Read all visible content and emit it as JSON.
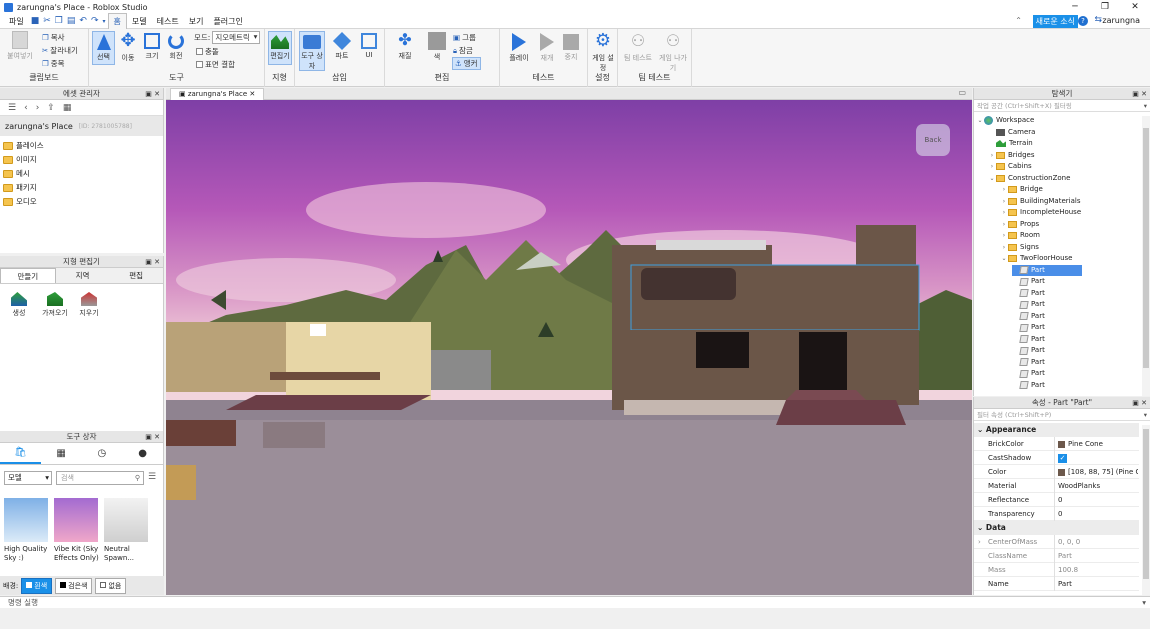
{
  "window": {
    "title": "zarungna's Place - Roblox Studio"
  },
  "menubar": {
    "items": [
      "파일",
      "홈",
      "모델",
      "테스트",
      "보기",
      "플러그인"
    ],
    "news": "새로운 소식",
    "user": "zarungna"
  },
  "ribbon": {
    "clipboard": {
      "label": "클립보드",
      "paste": "붙여넣기",
      "copy": "복사",
      "cut": "잘라내기",
      "duplicate": "중복"
    },
    "tools": {
      "label": "도구",
      "select": "선택",
      "move": "이동",
      "scale": "크기",
      "rotate": "회전",
      "mode_label": "모드:",
      "mode_value": "지오메트릭",
      "collisions": "충돌",
      "join_surfaces": "표면 결합"
    },
    "terrain": {
      "label": "지형",
      "editor": "편집기"
    },
    "insert": {
      "label": "삽입",
      "toolbox": "도구 상자",
      "part": "파트",
      "ui": "UI"
    },
    "edit": {
      "label": "편집",
      "material": "재질",
      "color": "색",
      "group": "그룹",
      "lock": "잠금",
      "anchor": "앵커"
    },
    "test": {
      "label": "테스트",
      "play": "플레이",
      "resume": "재개",
      "stop": "중지"
    },
    "settings": {
      "label": "설정",
      "game_settings": "게임 설정"
    },
    "team_test": {
      "label": "팀 테스트",
      "team_test": "팀 테스트",
      "exit_game": "게임 나가기"
    }
  },
  "asset_manager": {
    "title": "에셋 관리자",
    "place_name": "zarungna's Place",
    "place_id": "[ID: 2781005788]",
    "folders": [
      "플레이스",
      "이미지",
      "메시",
      "패키지",
      "오디오"
    ]
  },
  "terrain_editor": {
    "title": "지형 편집기",
    "tabs": [
      "만들기",
      "지역",
      "편집"
    ],
    "tools": [
      "생성",
      "가져오기",
      "지우기"
    ]
  },
  "toolbox": {
    "title": "도구 상자",
    "category": "모델",
    "search_placeholder": "검색",
    "items": [
      {
        "name": "High Quality Sky :)"
      },
      {
        "name": "Vibe Kit (Sky Effects Only)"
      },
      {
        "name": "Neutral Spawn..."
      }
    ],
    "bg_label": "배경:",
    "bg_options": [
      "흰색",
      "검은색",
      "없음"
    ]
  },
  "viewport": {
    "tab": "zarungna's Place",
    "back_button": "Back"
  },
  "explorer": {
    "title": "탐색기",
    "filter_placeholder": "작업 공간 (Ctrl+Shift+X) 필터링",
    "items": [
      {
        "label": "Workspace",
        "depth": 0,
        "icon": "globe-icon",
        "expanded": true
      },
      {
        "label": "Camera",
        "depth": 1,
        "icon": "camera-icon"
      },
      {
        "label": "Terrain",
        "depth": 1,
        "icon": "terrain-icon"
      },
      {
        "label": "Bridges",
        "depth": 1,
        "icon": "folder-icon",
        "collapsed": true
      },
      {
        "label": "Cabins",
        "depth": 1,
        "icon": "folder-icon",
        "collapsed": true
      },
      {
        "label": "ConstructionZone",
        "depth": 1,
        "icon": "folder-icon",
        "expanded": true
      },
      {
        "label": "Bridge",
        "depth": 2,
        "icon": "folder-icon",
        "collapsed": true
      },
      {
        "label": "BuildingMaterials",
        "depth": 2,
        "icon": "folder-icon",
        "collapsed": true
      },
      {
        "label": "IncompleteHouse",
        "depth": 2,
        "icon": "folder-icon",
        "collapsed": true
      },
      {
        "label": "Props",
        "depth": 2,
        "icon": "folder-icon",
        "collapsed": true
      },
      {
        "label": "Room",
        "depth": 2,
        "icon": "folder-icon",
        "collapsed": true
      },
      {
        "label": "Signs",
        "depth": 2,
        "icon": "folder-icon",
        "collapsed": true
      },
      {
        "label": "TwoFloorHouse",
        "depth": 2,
        "icon": "folder-icon",
        "expanded": true
      },
      {
        "label": "Part",
        "depth": 3,
        "icon": "part-icon",
        "selected": true
      },
      {
        "label": "Part",
        "depth": 3,
        "icon": "part-icon"
      },
      {
        "label": "Part",
        "depth": 3,
        "icon": "part-icon"
      },
      {
        "label": "Part",
        "depth": 3,
        "icon": "part-icon"
      },
      {
        "label": "Part",
        "depth": 3,
        "icon": "part-icon"
      },
      {
        "label": "Part",
        "depth": 3,
        "icon": "part-icon"
      },
      {
        "label": "Part",
        "depth": 3,
        "icon": "part-icon"
      },
      {
        "label": "Part",
        "depth": 3,
        "icon": "part-icon"
      },
      {
        "label": "Part",
        "depth": 3,
        "icon": "part-icon"
      },
      {
        "label": "Part",
        "depth": 3,
        "icon": "part-icon"
      },
      {
        "label": "Part",
        "depth": 3,
        "icon": "part-icon"
      },
      {
        "label": "Part",
        "depth": 3,
        "icon": "part-icon"
      }
    ]
  },
  "properties": {
    "title": "속성 - Part \"Part\"",
    "filter_placeholder": "필터 속성 (Ctrl+Shift+P)",
    "categories": [
      {
        "name": "Appearance",
        "rows": [
          {
            "name": "BrickColor",
            "value": "Pine Cone",
            "swatch": "#6c584b"
          },
          {
            "name": "CastShadow",
            "value": "",
            "checkbox": true
          },
          {
            "name": "Color",
            "value": "[108, 88, 75] (Pine C...",
            "swatch": "#6c584b"
          },
          {
            "name": "Material",
            "value": "WoodPlanks"
          },
          {
            "name": "Reflectance",
            "value": "0"
          },
          {
            "name": "Transparency",
            "value": "0"
          }
        ]
      },
      {
        "name": "Data",
        "rows": [
          {
            "name": "CenterOfMass",
            "value": "0, 0, 0",
            "readonly": true,
            "expandable": true
          },
          {
            "name": "ClassName",
            "value": "Part",
            "readonly": true
          },
          {
            "name": "Mass",
            "value": "100.8",
            "readonly": true
          },
          {
            "name": "Name",
            "value": "Part"
          }
        ]
      }
    ]
  },
  "command_bar": {
    "placeholder": "명령 실행"
  }
}
